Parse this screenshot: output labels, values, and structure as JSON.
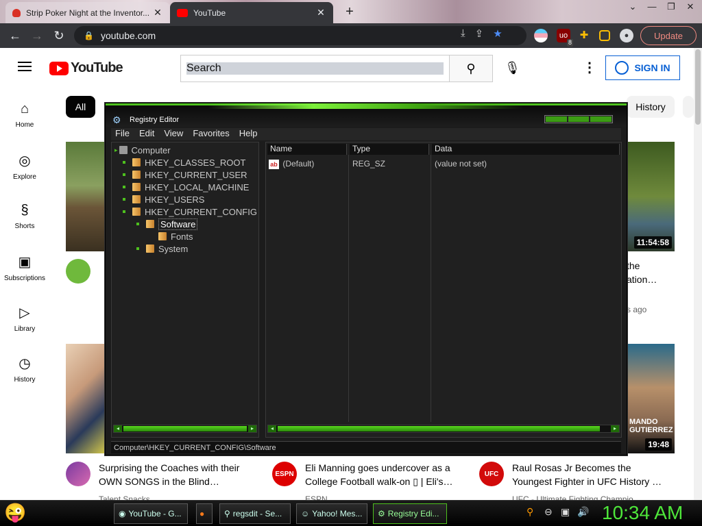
{
  "browser": {
    "tabs": [
      {
        "title": "Strip Poker Night at the Inventor...",
        "active": false
      },
      {
        "title": "YouTube",
        "active": true
      }
    ],
    "url": "youtube.com",
    "update_label": "Update",
    "ext_badge": "8"
  },
  "youtube": {
    "logo_text": "YouTube",
    "search_placeholder": "Search",
    "sign_in": "SIGN IN",
    "nav": [
      "Home",
      "Explore",
      "Shorts",
      "Subscriptions",
      "Library",
      "History"
    ],
    "chips": {
      "selected": "All",
      "last": "History"
    },
    "videos": {
      "v1_duration": "11:54:58",
      "v1_title_right": "the",
      "v1_title_right2": "ation…",
      "v1_meta_right": "s ago",
      "v2_duration": "19:48",
      "v3_title_1": "Surprising the Coaches with their",
      "v3_title_2": "OWN SONGS in the Blind…",
      "v3_channel": "Talent Snacks",
      "v4_title_1": "Eli Manning goes undercover as a",
      "v4_title_2": "College Football walk-on ▯ | Eli's…",
      "v4_channel": "ESPN",
      "v5_title_1": "Raul Rosas Jr Becomes the",
      "v5_title_2": "Youngest Fighter in UFC History …",
      "v5_channel": "UFC - Ultimate Fighting Champio…",
      "thumb_caption": "MANDO\nGUTIERREZ",
      "espn": "ESPN",
      "ufc": "UFC"
    }
  },
  "regedit": {
    "title": "Registry Editor",
    "menu": [
      "File",
      "Edit",
      "View",
      "Favorites",
      "Help"
    ],
    "tree": {
      "root": "Computer",
      "hkeys": [
        "HKEY_CLASSES_ROOT",
        "HKEY_CURRENT_USER",
        "HKEY_LOCAL_MACHINE",
        "HKEY_USERS",
        "HKEY_CURRENT_CONFIG"
      ],
      "software": "Software",
      "fonts": "Fonts",
      "system": "System"
    },
    "columns": [
      "Name",
      "Type",
      "Data"
    ],
    "row": {
      "name": "(Default)",
      "type": "REG_SZ",
      "data": "(value not set)"
    },
    "status_path": "Computer\\HKEY_CURRENT_CONFIG\\Software"
  },
  "taskbar": {
    "tasks": [
      "YouTube - G...",
      "regsdit - Se...",
      "Yahoo! Mes...",
      "Registry Edi..."
    ],
    "clock": "10:34 AM"
  }
}
